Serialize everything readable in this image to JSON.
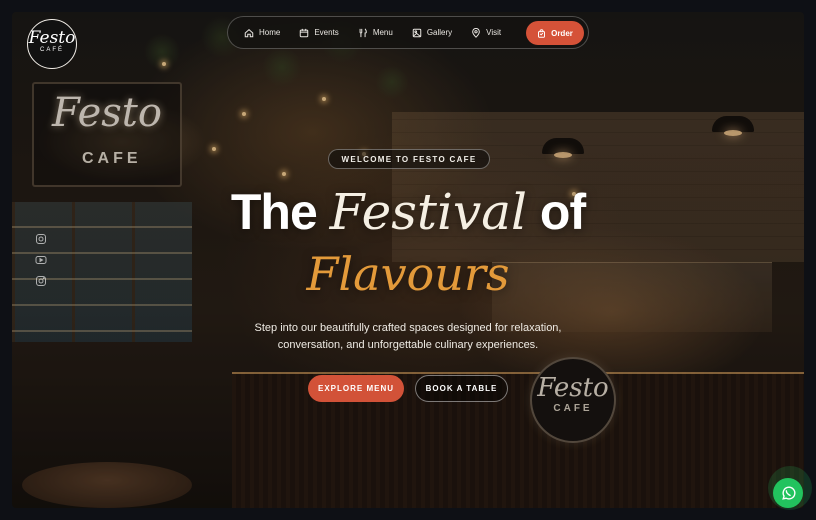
{
  "brand": {
    "logo_script": "Festo",
    "logo_caps": "CAFÉ"
  },
  "nav": {
    "items": [
      {
        "label": "Home",
        "icon": "home-icon"
      },
      {
        "label": "Events",
        "icon": "calendar-icon"
      },
      {
        "label": "Menu",
        "icon": "utensils-icon"
      },
      {
        "label": "Gallery",
        "icon": "image-icon"
      },
      {
        "label": "Visit",
        "icon": "map-pin-icon"
      }
    ],
    "order_label": "Order",
    "order_icon": "bag-icon"
  },
  "scene": {
    "wall_sign_script": "Festo",
    "wall_sign_caps": "CAFE",
    "round_sign_script": "Festo",
    "round_sign_caps": "CAFE"
  },
  "social": [
    "instagram-icon",
    "youtube-icon",
    "instagram-icon"
  ],
  "hero": {
    "badge": "WELCOME TO FESTO CAFE",
    "title_the": "The",
    "title_festival": "Festival",
    "title_of": "of",
    "title_flavours": "Flavours",
    "subtitle_line1": "Step into our beautifully crafted spaces designed for relaxation,",
    "subtitle_line2": "conversation, and unforgettable culinary experiences.",
    "explore_label": "EXPLORE MENU",
    "book_label": "BOOK A TABLE"
  },
  "colors": {
    "accent": "#d55238",
    "gold": "#e39a3a",
    "whatsapp": "#22c35e"
  },
  "floating": {
    "whatsapp_icon": "whatsapp-icon"
  }
}
